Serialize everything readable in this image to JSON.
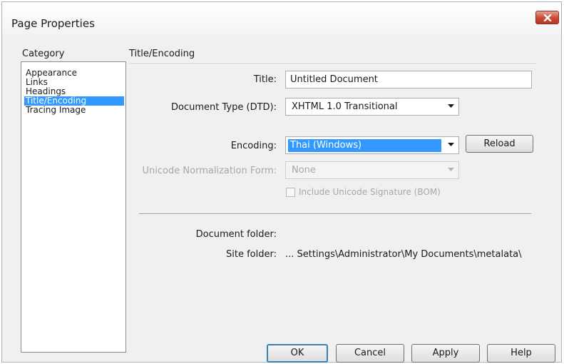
{
  "window": {
    "title": "Page Properties"
  },
  "category": {
    "label": "Category",
    "items": [
      {
        "label": "Appearance",
        "selected": false
      },
      {
        "label": "Links",
        "selected": false
      },
      {
        "label": "Headings",
        "selected": false
      },
      {
        "label": "Title/Encoding",
        "selected": true
      },
      {
        "label": "Tracing Image",
        "selected": false
      }
    ]
  },
  "section": {
    "header": "Title/Encoding"
  },
  "form": {
    "title_label": "Title:",
    "title_value": "Untitled Document",
    "doctype_label": "Document Type (DTD):",
    "doctype_value": "XHTML 1.0 Transitional",
    "encoding_label": "Encoding:",
    "encoding_value": "Thai (Windows)",
    "reload_label": "Reload",
    "normalization_label": "Unicode Normalization Form:",
    "normalization_value": "None",
    "bom_label": "Include Unicode Signature (BOM)",
    "bom_checked": false,
    "document_folder_label": "Document folder:",
    "document_folder_value": "",
    "site_folder_label": "Site folder:",
    "site_folder_value": "... Settings\\Administrator\\My Documents\\metalata\\"
  },
  "buttons": {
    "ok": "OK",
    "cancel": "Cancel",
    "apply": "Apply",
    "help": "Help"
  },
  "colors": {
    "selection": "#3399ff",
    "close_button": "#c74a34",
    "default_button_border": "#3c7fb1"
  },
  "icons": {
    "close": "close-icon",
    "dropdown": "chevron-down-icon"
  }
}
